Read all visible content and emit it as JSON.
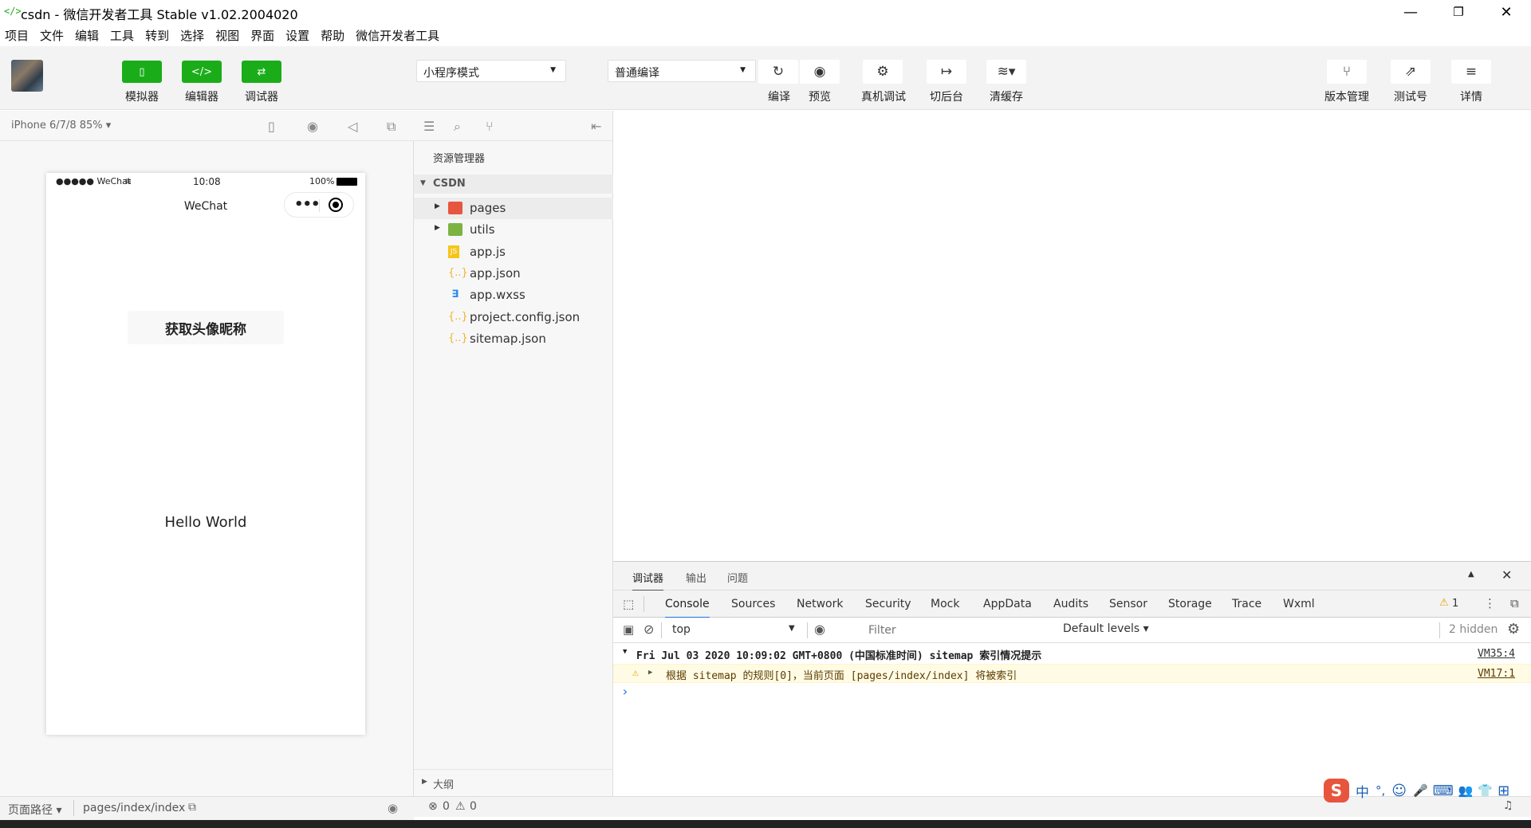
{
  "window": {
    "logo": "</>",
    "title": "csdn - 微信开发者工具 Stable v1.02.2004020",
    "minimize": "—",
    "maximize": "❐",
    "close": "✕"
  },
  "menu": [
    "项目",
    "文件",
    "编辑",
    "工具",
    "转到",
    "选择",
    "视图",
    "界面",
    "设置",
    "帮助",
    "微信开发者工具"
  ],
  "toolbar": {
    "left_buttons": [
      {
        "label": "模拟器",
        "icon": "phone-icon",
        "glyph": "▯"
      },
      {
        "label": "编辑器",
        "icon": "code-icon",
        "glyph": "</>"
      },
      {
        "label": "调试器",
        "icon": "debug-icon",
        "glyph": "⇄"
      }
    ],
    "mode_select": "小程序模式",
    "compile_select": "普通编译",
    "center_buttons": [
      {
        "label": "编译",
        "icon": "refresh-icon",
        "glyph": "↻"
      },
      {
        "label": "预览",
        "icon": "eye-icon",
        "glyph": "◉"
      },
      {
        "label": "真机调试",
        "icon": "bug-icon",
        "glyph": "⚙"
      },
      {
        "label": "切后台",
        "icon": "switch-icon",
        "glyph": "↦"
      },
      {
        "label": "清缓存",
        "icon": "layers-icon",
        "glyph": "≋▾"
      }
    ],
    "right_buttons": [
      {
        "label": "版本管理",
        "icon": "branch-icon",
        "glyph": "⑂"
      },
      {
        "label": "测试号",
        "icon": "external-icon",
        "glyph": "⇗"
      },
      {
        "label": "详情",
        "icon": "menu-icon",
        "glyph": "≡"
      }
    ]
  },
  "simulator": {
    "device": "iPhone 6/7/8 85% ▾",
    "status_left": "●●●●● WeChat",
    "time": "10:08",
    "battery": "100%",
    "nav_title": "WeChat",
    "button_text": "获取头像昵称",
    "hello": "Hello World",
    "footer_path_label": "页面路径 ▾",
    "footer_path": "pages/index/index"
  },
  "explorer": {
    "header": "资源管理器",
    "project": "CSDN",
    "items": [
      {
        "name": "pages",
        "type": "folder",
        "color": "#e8553e"
      },
      {
        "name": "utils",
        "type": "folder",
        "color": "#7cb342"
      },
      {
        "name": "app.js",
        "type": "js",
        "color": "#f5c518"
      },
      {
        "name": "app.json",
        "type": "json",
        "color": "#f0b429"
      },
      {
        "name": "app.wxss",
        "type": "wxss",
        "color": "#2d8cf0"
      },
      {
        "name": "project.config.json",
        "type": "json",
        "color": "#f0b429"
      },
      {
        "name": "sitemap.json",
        "type": "json",
        "color": "#f0b429"
      }
    ],
    "outline": "大纲"
  },
  "devtools": {
    "top_tabs": [
      "调试器",
      "输出",
      "问题"
    ],
    "tabs": [
      "Console",
      "Sources",
      "Network",
      "Security",
      "Mock",
      "AppData",
      "Audits",
      "Sensor",
      "Storage",
      "Trace",
      "Wxml"
    ],
    "warning_count": "1",
    "context": "top",
    "filter_placeholder": "Filter",
    "levels": "Default levels ▾",
    "hidden": "2 hidden",
    "logs": [
      {
        "text": "Fri Jul 03 2020 10:09:02 GMT+0800 (中国标准时间) sitemap 索引情况提示",
        "link": "VM35:4",
        "kind": "group"
      },
      {
        "text": "根据 sitemap 的规则[0]，当前页面 [pages/index/index] 将被索引",
        "link": "VM17:1",
        "kind": "warning"
      }
    ],
    "prompt": "›"
  },
  "statusbar": {
    "errors": "0",
    "warnings": "0"
  },
  "ime": [
    "中",
    "°,",
    "☺",
    "🎤",
    "⌨",
    "👥",
    "👕",
    "⊞"
  ],
  "colors": {
    "accent": "#1aad19",
    "warning_bg": "#fffbe5",
    "warning_text": "#5c3c00",
    "ime_logo": "#e8553e"
  }
}
